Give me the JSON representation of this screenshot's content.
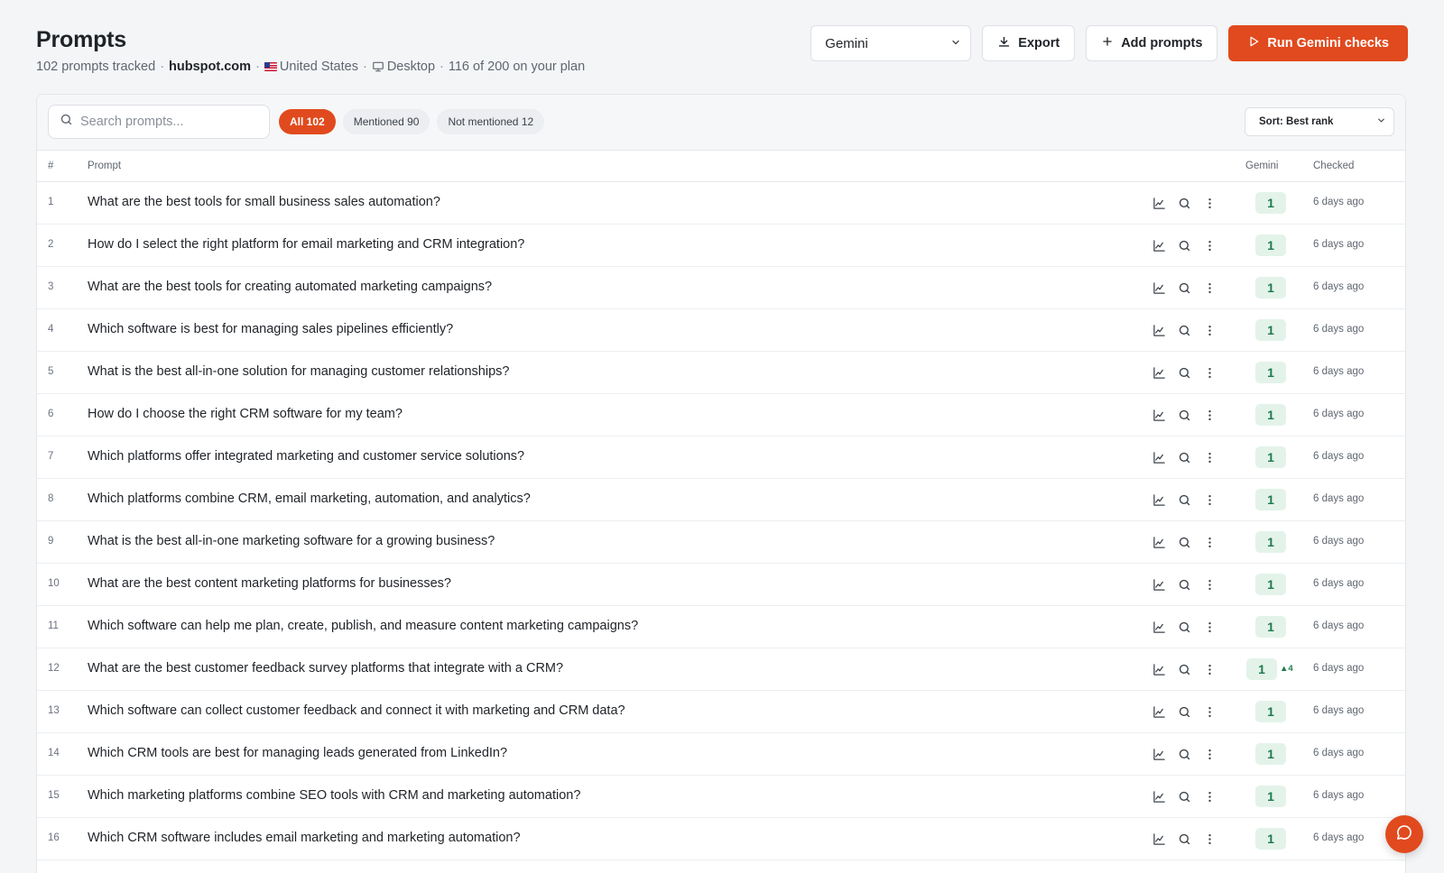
{
  "header": {
    "title": "Prompts",
    "tracked": "102 prompts tracked",
    "domain": "hubspot.com",
    "country": "United States",
    "device": "Desktop",
    "plan": "116 of 200 on your plan",
    "separator": "·"
  },
  "actions": {
    "model_selected": "Gemini",
    "export_label": "Export",
    "add_label": "Add prompts",
    "run_label": "Run Gemini checks"
  },
  "toolbar": {
    "search_placeholder": "Search prompts...",
    "filters": [
      {
        "label": "All 102",
        "active": true
      },
      {
        "label": "Mentioned 90",
        "active": false
      },
      {
        "label": "Not mentioned 12",
        "active": false
      }
    ],
    "sort_label": "Sort: Best rank"
  },
  "table": {
    "columns": {
      "num": "#",
      "prompt": "Prompt",
      "model": "Gemini",
      "checked": "Checked"
    },
    "rows": [
      {
        "num": "1",
        "prompt": "What are the best tools for small business sales automation?",
        "rank": "1",
        "delta": "",
        "checked": "6 days ago"
      },
      {
        "num": "2",
        "prompt": "How do I select the right platform for email marketing and CRM integration?",
        "rank": "1",
        "delta": "",
        "checked": "6 days ago"
      },
      {
        "num": "3",
        "prompt": "What are the best tools for creating automated marketing campaigns?",
        "rank": "1",
        "delta": "",
        "checked": "6 days ago"
      },
      {
        "num": "4",
        "prompt": "Which software is best for managing sales pipelines efficiently?",
        "rank": "1",
        "delta": "",
        "checked": "6 days ago"
      },
      {
        "num": "5",
        "prompt": "What is the best all-in-one solution for managing customer relationships?",
        "rank": "1",
        "delta": "",
        "checked": "6 days ago"
      },
      {
        "num": "6",
        "prompt": "How do I choose the right CRM software for my team?",
        "rank": "1",
        "delta": "",
        "checked": "6 days ago"
      },
      {
        "num": "7",
        "prompt": "Which platforms offer integrated marketing and customer service solutions?",
        "rank": "1",
        "delta": "",
        "checked": "6 days ago"
      },
      {
        "num": "8",
        "prompt": "Which platforms combine CRM, email marketing, automation, and analytics?",
        "rank": "1",
        "delta": "",
        "checked": "6 days ago"
      },
      {
        "num": "9",
        "prompt": "What is the best all-in-one marketing software for a growing business?",
        "rank": "1",
        "delta": "",
        "checked": "6 days ago"
      },
      {
        "num": "10",
        "prompt": "What are the best content marketing platforms for businesses?",
        "rank": "1",
        "delta": "",
        "checked": "6 days ago"
      },
      {
        "num": "11",
        "prompt": "Which software can help me plan, create, publish, and measure content marketing campaigns?",
        "rank": "1",
        "delta": "",
        "checked": "6 days ago"
      },
      {
        "num": "12",
        "prompt": "What are the best customer feedback survey platforms that integrate with a CRM?",
        "rank": "1",
        "delta": "▲4",
        "checked": "6 days ago"
      },
      {
        "num": "13",
        "prompt": "Which software can collect customer feedback and connect it with marketing and CRM data?",
        "rank": "1",
        "delta": "",
        "checked": "6 days ago"
      },
      {
        "num": "14",
        "prompt": "Which CRM tools are best for managing leads generated from LinkedIn?",
        "rank": "1",
        "delta": "",
        "checked": "6 days ago"
      },
      {
        "num": "15",
        "prompt": "Which marketing platforms combine SEO tools with CRM and marketing automation?",
        "rank": "1",
        "delta": "",
        "checked": "6 days ago"
      },
      {
        "num": "16",
        "prompt": "Which CRM software includes email marketing and marketing automation?",
        "rank": "1",
        "delta": "",
        "checked": "6 days ago"
      }
    ]
  },
  "icons": {
    "row_actions": [
      "chart-icon",
      "search-icon",
      "more-vertical-icon"
    ],
    "chat": "chat-icon"
  },
  "colors": {
    "accent": "#e14a1e",
    "rank_bg": "#e3f3ea",
    "rank_text": "#1e7a4c"
  }
}
